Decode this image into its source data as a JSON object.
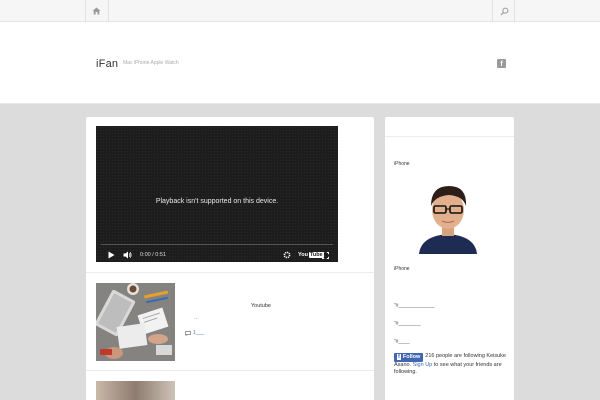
{
  "topbar": {
    "home_icon": "home-icon",
    "search_icon": "search-icon"
  },
  "header": {
    "site_title": "iFan",
    "site_description": "Mac iPhone Apple Watch",
    "social_icon": "facebook-icon",
    "social_icon_glyph": "f"
  },
  "video": {
    "message": "Playback isn't supported on this device.",
    "time": "0:00 / 0:51",
    "logo_you": "You",
    "logo_tube": "Tube",
    "progress": 0
  },
  "post": {
    "title": "Youtube",
    "excerpt": "…",
    "comments": "1___"
  },
  "sidebar": {
    "label_top": "iPhone",
    "label_profile": "iPhone",
    "links": [
      "\"#_____________",
      "\"#________",
      "\"#____"
    ],
    "facebook": {
      "button_label": "Follow",
      "button_glyph": "f",
      "text_before": "216 people are following Keisuke Asano.",
      "link": "Sign Up",
      "text_after": "to see what your friends are following."
    }
  },
  "colors": {
    "background": "#dcdcdc",
    "facebook_blue": "#4267b2",
    "video_bg": "#1d1d1d"
  }
}
